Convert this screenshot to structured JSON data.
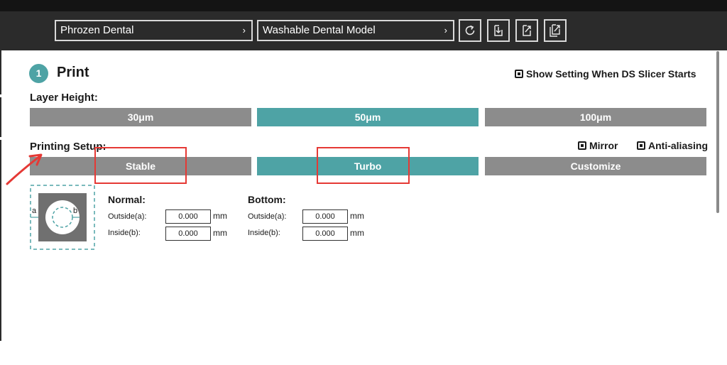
{
  "toolbar": {
    "printer": "Phrozen Dental",
    "resin": "Washable Dental Model",
    "chevron": "›",
    "icons": [
      "reset-icon",
      "import-icon",
      "export-icon",
      "export-copy-icon"
    ]
  },
  "section": {
    "step": "1",
    "title": "Print",
    "show_setting": "Show Setting When DS Slicer Starts"
  },
  "layer_height": {
    "label": "Layer Height:",
    "options": [
      "30μm",
      "50μm",
      "100μm"
    ],
    "selected": "50μm"
  },
  "printing_setup": {
    "label": "Printing Setup:",
    "mirror": "Mirror",
    "anti_aliasing": "Anti-aliasing",
    "options": [
      "Stable",
      "Turbo",
      "Customize"
    ],
    "selected": "Turbo"
  },
  "diagram": {
    "a": "a",
    "b": "b"
  },
  "normal": {
    "label": "Normal:",
    "outside_label": "Outside(a):",
    "outside_value": "0.000",
    "inside_label": "Inside(b):",
    "inside_value": "0.000",
    "unit": "mm"
  },
  "bottom": {
    "label": "Bottom:",
    "outside_label": "Outside(a):",
    "outside_value": "0.000",
    "inside_label": "Inside(b):",
    "inside_value": "0.000",
    "unit": "mm"
  },
  "colors": {
    "accent": "#4ea3a5",
    "inactive": "#8c8c8c",
    "toolbar": "#2b2b2b",
    "annotation": "#e53935"
  }
}
